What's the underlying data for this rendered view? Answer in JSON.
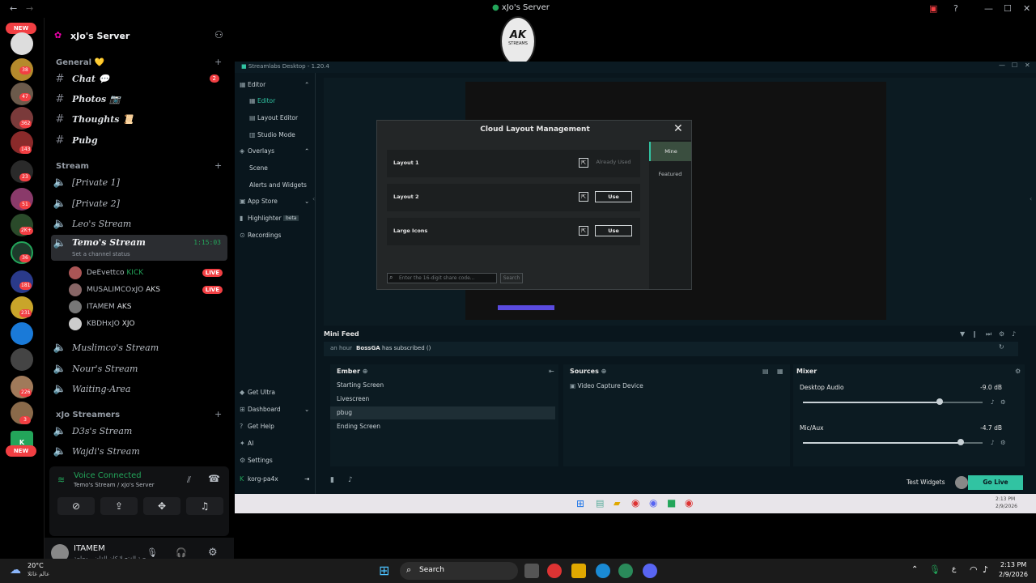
{
  "window": {
    "title": "xJo's Server"
  },
  "server_rail": {
    "new_label_top": "NEW",
    "new_label_bottom": "NEW",
    "badges": [
      "38",
      "47",
      "362",
      "143",
      "23",
      "51",
      "2K+",
      "36",
      "181",
      "231",
      "226",
      "3"
    ]
  },
  "server": {
    "name": "xJo's Server"
  },
  "categories": {
    "general": "General 💛",
    "stream": "Stream",
    "streamers": "xJo Streamers"
  },
  "text_channels": [
    {
      "label": "Chat 💬",
      "badge": "2"
    },
    {
      "label": "Photos 📷"
    },
    {
      "label": "Thoughts 📜"
    },
    {
      "label": "Pubg"
    }
  ],
  "voice_channels": [
    {
      "label": "[Private 1]"
    },
    {
      "label": "[Private 2]"
    },
    {
      "label": "Leo's Stream"
    },
    {
      "label": "Temo's Stream",
      "time": "1:15:03",
      "status": "Set a channel status"
    },
    {
      "label": "Muslimco's Stream"
    },
    {
      "label": "Nour's Stream"
    },
    {
      "label": "Waiting-Area"
    },
    {
      "label": "D3s's Stream"
    },
    {
      "label": "Wajdi's Stream"
    }
  ],
  "voice_users": [
    {
      "name": "DeEvettco",
      "tag": "KICK",
      "live": "LIVE"
    },
    {
      "name": "MUSALIMCOxJO",
      "tag": "AKS",
      "live": "LIVE"
    },
    {
      "name": "ITAMEM",
      "tag": "AKS"
    },
    {
      "name": "KBDHxJO",
      "tag": "XJO"
    }
  ],
  "voice_panel": {
    "status": "Voice Connected",
    "location": "Temo's Stream / xJo's Server"
  },
  "user_panel": {
    "name": "ITAMEM",
    "status": "اشتكي حبة الفتح لا كان القاضي دجاجة"
  },
  "overlay_logo": {
    "text": "AK",
    "sub": "STREAMS"
  },
  "streamlabs": {
    "title": "Streamlabs Desktop - 1.20.4",
    "nav": {
      "editor_group": "Editor",
      "editor": "Editor",
      "layout_editor": "Layout Editor",
      "studio_mode": "Studio Mode",
      "overlays": "Overlays",
      "scene": "Scene",
      "alerts": "Alerts and Widgets",
      "app_store": "App Store",
      "highlighter": "Highlighter",
      "beta": "beta",
      "recordings": "Recordings",
      "get_ultra": "Get Ultra",
      "dashboard": "Dashboard",
      "get_help": "Get Help",
      "ai": "AI",
      "settings": "Settings",
      "account": "korg-pa4x"
    },
    "modal": {
      "title": "Cloud Layout Management",
      "tabs": [
        "Mine",
        "Featured"
      ],
      "layouts": [
        {
          "name": "Layout 1",
          "action": "Already Used"
        },
        {
          "name": "Layout 2",
          "action": "Use"
        },
        {
          "name": "Large Icons",
          "action": "Use"
        }
      ],
      "code_placeholder": "Enter the 16-digit share code...",
      "search": "Search"
    },
    "mini_feed": {
      "title": "Mini Feed",
      "time": "an hour",
      "user": "BossGA",
      "event": "has subscribed ()"
    },
    "scenes": {
      "title": "Ember",
      "items": [
        "Starting Screen",
        "Livescreen",
        "pbug",
        "Ending Screen"
      ],
      "selected": 2
    },
    "sources": {
      "title": "Sources",
      "items": [
        "Video Capture Device"
      ]
    },
    "mixer": {
      "title": "Mixer",
      "channels": [
        {
          "name": "Desktop Audio",
          "db": "-9.0 dB",
          "level": 0.76
        },
        {
          "name": "Mic/Aux",
          "db": "-4.7 dB",
          "level": 0.88
        }
      ]
    },
    "footer": {
      "test_widgets": "Test Widgets",
      "go_live": "Go Live"
    }
  },
  "inner_clock": {
    "time": "2:13 PM",
    "date": "2/9/2026"
  },
  "taskbar": {
    "weather_temp": "20°C",
    "weather_desc": "عالم غائلا",
    "search": "Search",
    "lang": "ع",
    "time": "2:13 PM",
    "date": "2/9/2026"
  }
}
